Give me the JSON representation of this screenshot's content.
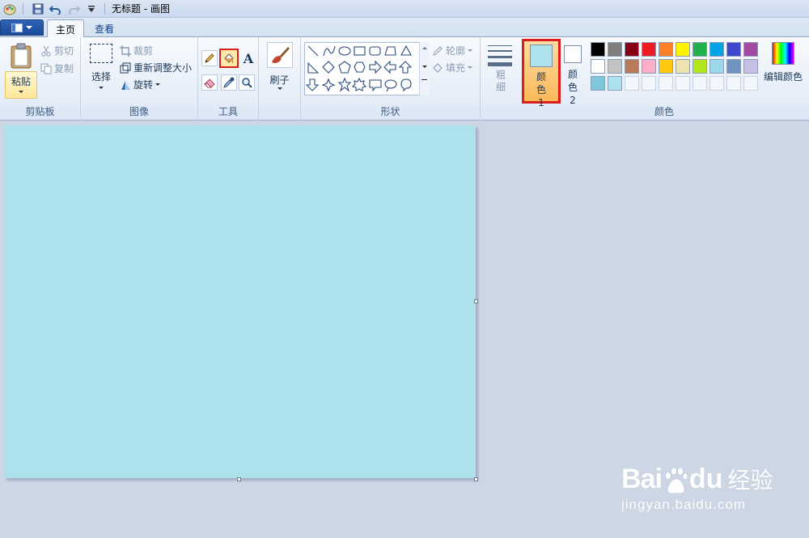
{
  "window": {
    "title": "无标题 - 画图",
    "quick_access": [
      "paint-app-icon",
      "save-icon",
      "undo-icon",
      "redo-icon",
      "customize-icon"
    ]
  },
  "tabs": [
    {
      "label": "主页",
      "active": true
    },
    {
      "label": "查看",
      "active": false
    }
  ],
  "ribbon": {
    "clipboard": {
      "label": "剪贴板",
      "paste": "粘贴",
      "cut": "剪切",
      "copy": "复制"
    },
    "image": {
      "label": "图像",
      "select": "选择",
      "crop": "裁剪",
      "resize": "重新调整大小",
      "rotate": "旋转"
    },
    "tools": {
      "label": "工具",
      "items": [
        "pencil-icon",
        "fill-bucket-icon",
        "text-icon",
        "eraser-icon",
        "color-picker-icon",
        "magnifier-icon"
      ],
      "selected": "fill-bucket-icon"
    },
    "brushes": {
      "label": "刷子"
    },
    "shapes": {
      "label": "形状",
      "outline": "轮廓",
      "fill": "填充"
    },
    "size": {
      "label": "粗细"
    },
    "colors": {
      "label": "颜色",
      "color1_label": "颜色 1",
      "color2_label": "颜色 2",
      "color1": "#ade2ec",
      "color2": "#ffffff",
      "edit_colors": "编辑颜色",
      "palette_row1": [
        "#000000",
        "#7f7f7f",
        "#880015",
        "#ed1c24",
        "#ff7f27",
        "#fff200",
        "#22b14c",
        "#00a2e8",
        "#3f48cc",
        "#a349a4"
      ],
      "palette_row2": [
        "#ffffff",
        "#c3c3c3",
        "#b97a57",
        "#ffaec9",
        "#ffc90e",
        "#efe4b0",
        "#b5e61d",
        "#99d9ea",
        "#7092be",
        "#c8bfe7"
      ],
      "palette_row3": [
        "#7dc6dc",
        "#ade2ec",
        "",
        "",
        "",
        "",
        "",
        "",
        "",
        ""
      ]
    }
  },
  "canvas": {
    "background": "#ade2ec"
  },
  "watermark": {
    "brand": "Bai",
    "brand2": "du",
    "cn": "经验",
    "url": "jingyan.baidu.com"
  }
}
